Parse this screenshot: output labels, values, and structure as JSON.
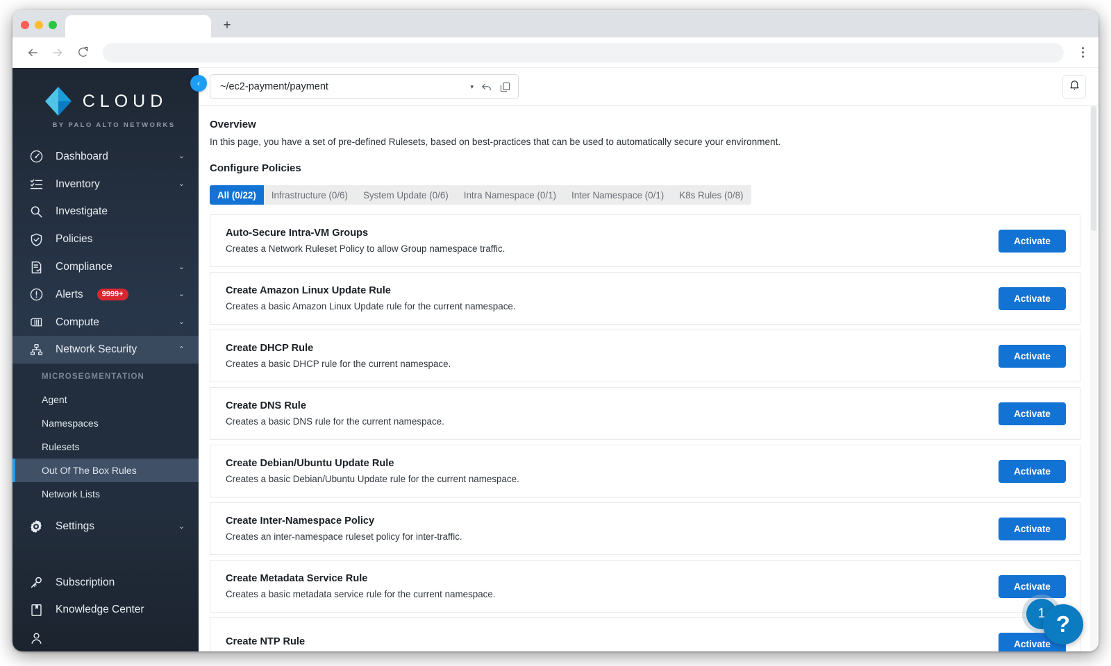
{
  "browser": {
    "tab_title": "",
    "new_tab_label": "+",
    "back_icon": "back-arrow-icon",
    "forward_icon": "forward-arrow-icon",
    "reload_icon": "reload-icon",
    "address_value": "",
    "address_placeholder": "",
    "menu_icon": "kebab-menu-icon"
  },
  "sidebar": {
    "logo_word": "CLOUD",
    "logo_sub": "BY PALO ALTO NETWORKS",
    "collapse_label": "‹",
    "items": [
      {
        "label": "Dashboard",
        "icon": "gauge-icon",
        "chevron": "⌄"
      },
      {
        "label": "Inventory",
        "icon": "list-check-icon",
        "chevron": "⌄"
      },
      {
        "label": "Investigate",
        "icon": "magnifier-icon",
        "chevron": ""
      },
      {
        "label": "Policies",
        "icon": "shield-check-icon",
        "chevron": ""
      },
      {
        "label": "Compliance",
        "icon": "document-check-icon",
        "chevron": "⌄"
      },
      {
        "label": "Alerts",
        "icon": "alert-circle-icon",
        "chevron": "⌄",
        "badge": "9999+"
      },
      {
        "label": "Compute",
        "icon": "container-icon",
        "chevron": "⌄"
      },
      {
        "label": "Network Security",
        "icon": "network-nodes-icon",
        "chevron": "⌃",
        "expanded": true
      }
    ],
    "submenu": {
      "heading": "MICROSEGMENTATION",
      "items": [
        {
          "label": "Agent"
        },
        {
          "label": "Namespaces"
        },
        {
          "label": "Rulesets"
        },
        {
          "label": "Out Of The Box Rules",
          "selected": true
        },
        {
          "label": "Network Lists"
        }
      ]
    },
    "items_after": [
      {
        "label": "Settings",
        "icon": "gear-icon",
        "chevron": "⌄"
      }
    ],
    "footer_items": [
      {
        "label": "Subscription",
        "icon": "key-icon"
      },
      {
        "label": "Knowledge Center",
        "icon": "book-icon"
      }
    ],
    "accent_color": "#1c9ef5",
    "background_color": "#28364a"
  },
  "header": {
    "namespace_value": "~/ec2-payment/payment",
    "namespace_caret": "caret-down-icon",
    "undo_icon": "undo-arrow-icon",
    "copy_icon": "copy-icon",
    "bell_icon": "bell-icon"
  },
  "main": {
    "overview_title": "Overview",
    "overview_desc": "In this page, you have a set of pre-defined Rulesets, based on best-practices that can be used to automatically secure your environment.",
    "configure_title": "Configure Policies",
    "tabs": [
      {
        "label": "All (0/22)",
        "selected": true
      },
      {
        "label": "Infrastructure (0/6)",
        "selected": false
      },
      {
        "label": "System Update (0/6)",
        "selected": false
      },
      {
        "label": "Intra Namespace (0/1)",
        "selected": false
      },
      {
        "label": "Inter Namespace (0/1)",
        "selected": false
      },
      {
        "label": "K8s Rules (0/8)",
        "selected": false
      }
    ],
    "activate_label": "Activate",
    "cards": [
      {
        "title": "Auto-Secure Intra-VM Groups",
        "desc": "Creates a Network Ruleset Policy to allow Group namespace traffic."
      },
      {
        "title": "Create Amazon Linux Update Rule",
        "desc": "Creates a basic Amazon Linux Update rule for the current namespace."
      },
      {
        "title": "Create DHCP Rule",
        "desc": "Creates a basic DHCP rule for the current namespace."
      },
      {
        "title": "Create DNS Rule",
        "desc": "Creates a basic DNS rule for the current namespace."
      },
      {
        "title": "Create Debian/Ubuntu Update Rule",
        "desc": "Creates a basic Debian/Ubuntu Update rule for the current namespace."
      },
      {
        "title": "Create Inter-Namespace Policy",
        "desc": "Creates an inter-namespace ruleset policy for inter-traffic."
      },
      {
        "title": "Create Metadata Service Rule",
        "desc": "Creates a basic metadata service rule for the current namespace."
      },
      {
        "title": "Create NTP Rule",
        "desc": ""
      }
    ],
    "accent_color": "#1273d4"
  },
  "help": {
    "count": "1",
    "icon_label": "?"
  }
}
